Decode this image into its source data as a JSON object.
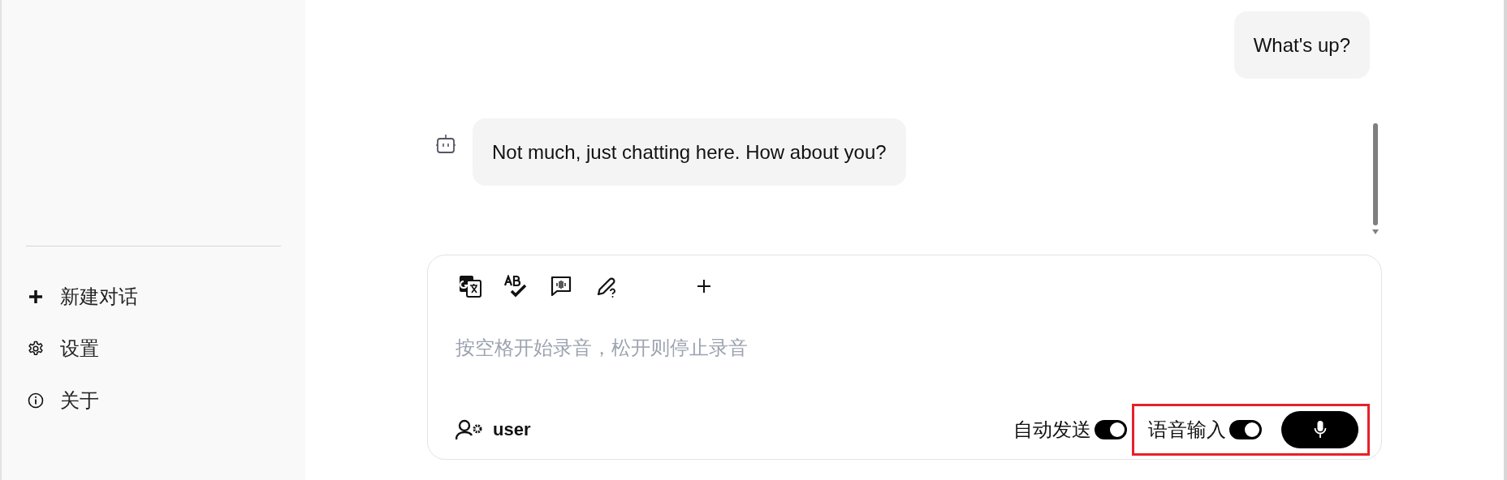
{
  "sidebar": {
    "items": [
      {
        "kind": "new",
        "label": "新建对话"
      },
      {
        "kind": "settings",
        "label": "设置"
      },
      {
        "kind": "about",
        "label": "关于"
      }
    ]
  },
  "messages": [
    {
      "kind": "user",
      "text": "What's up?"
    },
    {
      "kind": "assistant",
      "text": "Not much, just chatting here. How about you?"
    }
  ],
  "composer": {
    "tools": [
      {
        "kind": "translate"
      },
      {
        "kind": "spellcheck"
      },
      {
        "kind": "voice-chat"
      },
      {
        "kind": "edit-help"
      },
      {
        "kind": "add"
      }
    ],
    "placeholder": "按空格开始录音，松开则停止录音",
    "user": "user",
    "auto_send": {
      "label": "自动发送",
      "on": true
    },
    "voice_input": {
      "label": "语音输入",
      "on": true,
      "highlighted": true
    }
  }
}
